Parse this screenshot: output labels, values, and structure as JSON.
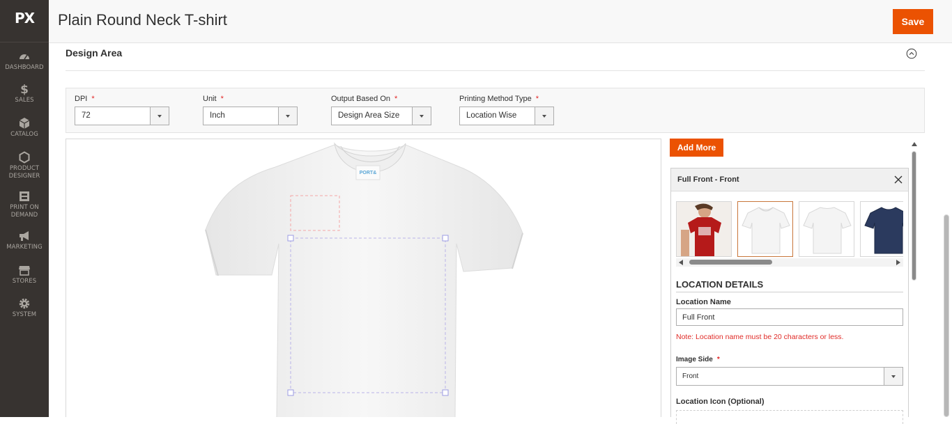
{
  "sidebar": {
    "logo": "PX",
    "items": [
      {
        "label": "DASHBOARD",
        "icon": "dashboard-icon"
      },
      {
        "label": "SALES",
        "icon": "dollar-icon"
      },
      {
        "label": "CATALOG",
        "icon": "cube-icon"
      },
      {
        "label": "PRODUCT DESIGNER",
        "icon": "hexagon-icon"
      },
      {
        "label": "PRINT ON DEMAND",
        "icon": "printer-icon"
      },
      {
        "label": "MARKETING",
        "icon": "megaphone-icon"
      },
      {
        "label": "STORES",
        "icon": "store-icon"
      },
      {
        "label": "SYSTEM",
        "icon": "gear-icon"
      }
    ]
  },
  "header": {
    "title": "Plain Round Neck T-shirt",
    "save_label": "Save"
  },
  "section": {
    "title": "Design Area"
  },
  "options": {
    "dpi": {
      "label": "DPI",
      "value": "72"
    },
    "unit": {
      "label": "Unit",
      "value": "Inch"
    },
    "output": {
      "label": "Output Based On",
      "value": "Design Area Size"
    },
    "printing": {
      "label": "Printing Method Type",
      "value": "Location Wise"
    },
    "required_mark": "*"
  },
  "canvas": {
    "product_tag": "PORT&\nCOMPANY"
  },
  "panel": {
    "add_more_label": "Add More",
    "title": "Full Front - Front",
    "thumbnails": [
      "red-tshirt-model",
      "white-tshirt-front",
      "white-tshirt-back",
      "navy-tshirt"
    ],
    "active_thumbnail": 1,
    "location_details_heading": "LOCATION DETAILS",
    "location_name_label": "Location Name",
    "location_name_value": "Full Front",
    "note": "Note: Location name must be 20 characters or less.",
    "image_side_label": "Image Side",
    "image_side_value": "Front",
    "location_icon_label": "Location Icon (Optional)"
  },
  "colors": {
    "accent": "#eb5202",
    "sidebar_bg": "#373330",
    "error": "#e02b27"
  }
}
